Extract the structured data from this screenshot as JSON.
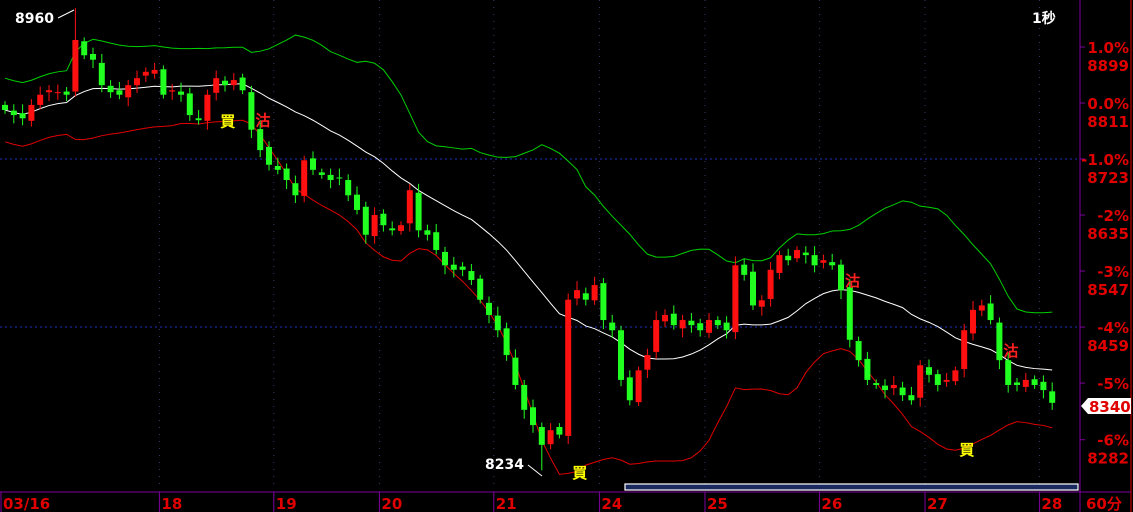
{
  "header": {
    "interval_label": "1秒",
    "period_label": "60分"
  },
  "chart_data": {
    "type": "candlestick",
    "title": "",
    "base_price": 8811,
    "y_ticks": [
      {
        "pct": "1.0%",
        "price": "8899",
        "value": 8899
      },
      {
        "pct": "0.0%",
        "price": "8811",
        "value": 8811
      },
      {
        "pct": "-1.0%",
        "price": "8723",
        "value": 8723
      },
      {
        "pct": "-2%",
        "price": "8635",
        "value": 8635
      },
      {
        "pct": "-3%",
        "price": "8547",
        "value": 8547
      },
      {
        "pct": "-4%",
        "price": "8459",
        "value": 8459
      },
      {
        "pct": "-5%",
        "price": "8371",
        "value": 8371
      },
      {
        "pct": "-6%",
        "price": "8282",
        "value": 8282
      }
    ],
    "ylim": [
      8230,
      8970
    ],
    "last_price": "8340",
    "high_label": "8960",
    "low_label": "8234",
    "extremes": {
      "high": {
        "index": 8,
        "value": 8960
      },
      "low": {
        "index": 61,
        "value": 8234
      }
    },
    "x_labels": [
      {
        "label": "03/16",
        "index": 0
      },
      {
        "label": "18",
        "index": 18
      },
      {
        "label": "19",
        "index": 31
      },
      {
        "label": "20",
        "index": 43
      },
      {
        "label": "21",
        "index": 56
      },
      {
        "label": "24",
        "index": 68
      },
      {
        "label": "25",
        "index": 80
      },
      {
        "label": "26",
        "index": 93
      },
      {
        "label": "27",
        "index": 105
      },
      {
        "label": "28",
        "index": 118
      }
    ],
    "closes": [
      8800,
      8792,
      8787,
      8808,
      8824,
      8831,
      8828,
      8824,
      8910,
      8886,
      8879,
      8839,
      8828,
      8824,
      8839,
      8850,
      8860,
      8863,
      8824,
      8831,
      8824,
      8792,
      8784,
      8824,
      8850,
      8839,
      8847,
      8831,
      8769,
      8737,
      8714,
      8706,
      8690,
      8666,
      8721,
      8706,
      8698,
      8690,
      8693,
      8666,
      8643,
      8604,
      8635,
      8619,
      8611,
      8619,
      8674,
      8611,
      8604,
      8580,
      8556,
      8549,
      8549,
      8533,
      8502,
      8478,
      8454,
      8415,
      8368,
      8329,
      8305,
      8274,
      8297,
      8290,
      8502,
      8517,
      8502,
      8525,
      8470,
      8454,
      8376,
      8344,
      8391,
      8415,
      8470,
      8478,
      8462,
      8470,
      8462,
      8454,
      8470,
      8462,
      8454,
      8556,
      8541,
      8493,
      8501,
      8549,
      8572,
      8564,
      8580,
      8572,
      8556,
      8564,
      8556,
      8517,
      8439,
      8407,
      8376,
      8368,
      8360,
      8368,
      8352,
      8344,
      8399,
      8384,
      8368,
      8376,
      8391,
      8454,
      8486,
      8493,
      8470,
      8407,
      8368,
      8368,
      8376,
      8368,
      8360,
      8340
    ],
    "indicators": [
      "Bollinger upper",
      "Moving average",
      "Bollinger lower"
    ],
    "signals": [
      {
        "label": "買",
        "type": "buy",
        "index": 24
      },
      {
        "label": "沽",
        "type": "sell",
        "index": 28
      },
      {
        "label": "買",
        "type": "buy",
        "index": 64
      },
      {
        "label": "沽",
        "type": "sell",
        "index": 95
      },
      {
        "label": "買",
        "type": "buy",
        "index": 108
      },
      {
        "label": "沽",
        "type": "sell",
        "index": 113
      }
    ],
    "colors": {
      "up": "#ff1010",
      "down": "#20ff20",
      "upper": "#00d000",
      "lower": "#e00000",
      "ma": "#ffffff",
      "axis": "#8000a0",
      "grid": "#2030c0"
    }
  }
}
